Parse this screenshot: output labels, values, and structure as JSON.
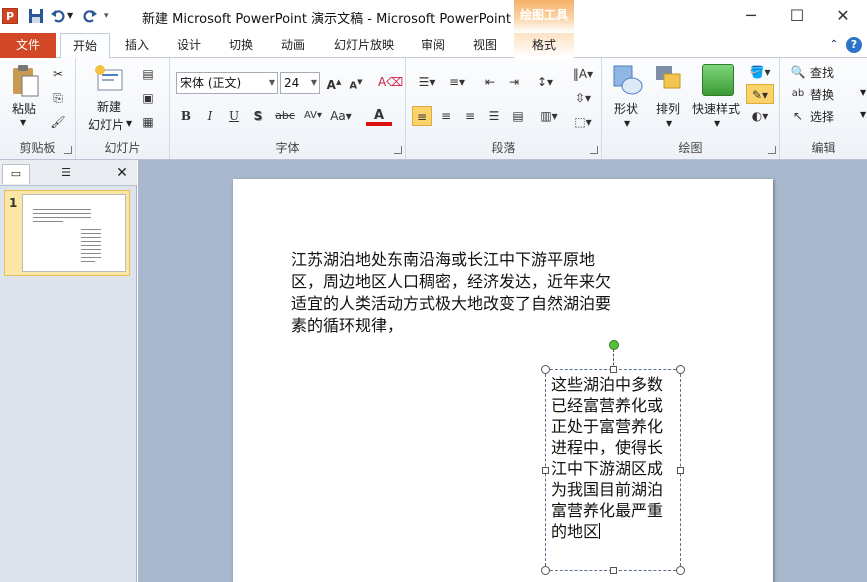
{
  "window": {
    "title": "新建 Microsoft PowerPoint 演示文稿 - Microsoft PowerPoint",
    "context_tool_title": "绘图工具",
    "app_logo": "P"
  },
  "tabs": [
    {
      "label": "文件"
    },
    {
      "label": "开始"
    },
    {
      "label": "插入"
    },
    {
      "label": "设计"
    },
    {
      "label": "切换"
    },
    {
      "label": "动画"
    },
    {
      "label": "幻灯片放映"
    },
    {
      "label": "审阅"
    },
    {
      "label": "视图"
    },
    {
      "label": "格式"
    }
  ],
  "ribbon": {
    "clipboard": {
      "label": "剪贴板",
      "paste": "粘贴"
    },
    "slides": {
      "label": "幻灯片",
      "new_slide_1": "新建",
      "new_slide_2": "幻灯片"
    },
    "font": {
      "label": "字体",
      "font_name": "宋体 (正文)",
      "font_size": "24"
    },
    "paragraph": {
      "label": "段落"
    },
    "drawing": {
      "label": "绘图",
      "shapes": "形状",
      "arrange": "排列",
      "quick_styles": "快速样式"
    },
    "editing": {
      "label": "编辑",
      "find": "查找",
      "replace": "替换",
      "select": "选择"
    }
  },
  "slide_panel": {
    "slide_number": "1"
  },
  "slide": {
    "paragraph1": "江苏湖泊地处东南沿海或长江中下游平原地区，周边地区人口稠密，经济发达，近年来欠适宜的人类活动方式极大地改变了自然湖泊要素的循环规律，",
    "paragraph2": "这些湖泊中多数已经富营养化或正处于富营养化进程中，使得长江中下游湖区成为我国目前湖泊富营养化最严重的地区"
  },
  "colors": {
    "file_tab": "#d24726",
    "context_tab": "#f7b16a",
    "editor_bg": "#a9b8cd",
    "ribbon_bg": "#eef2f8"
  }
}
